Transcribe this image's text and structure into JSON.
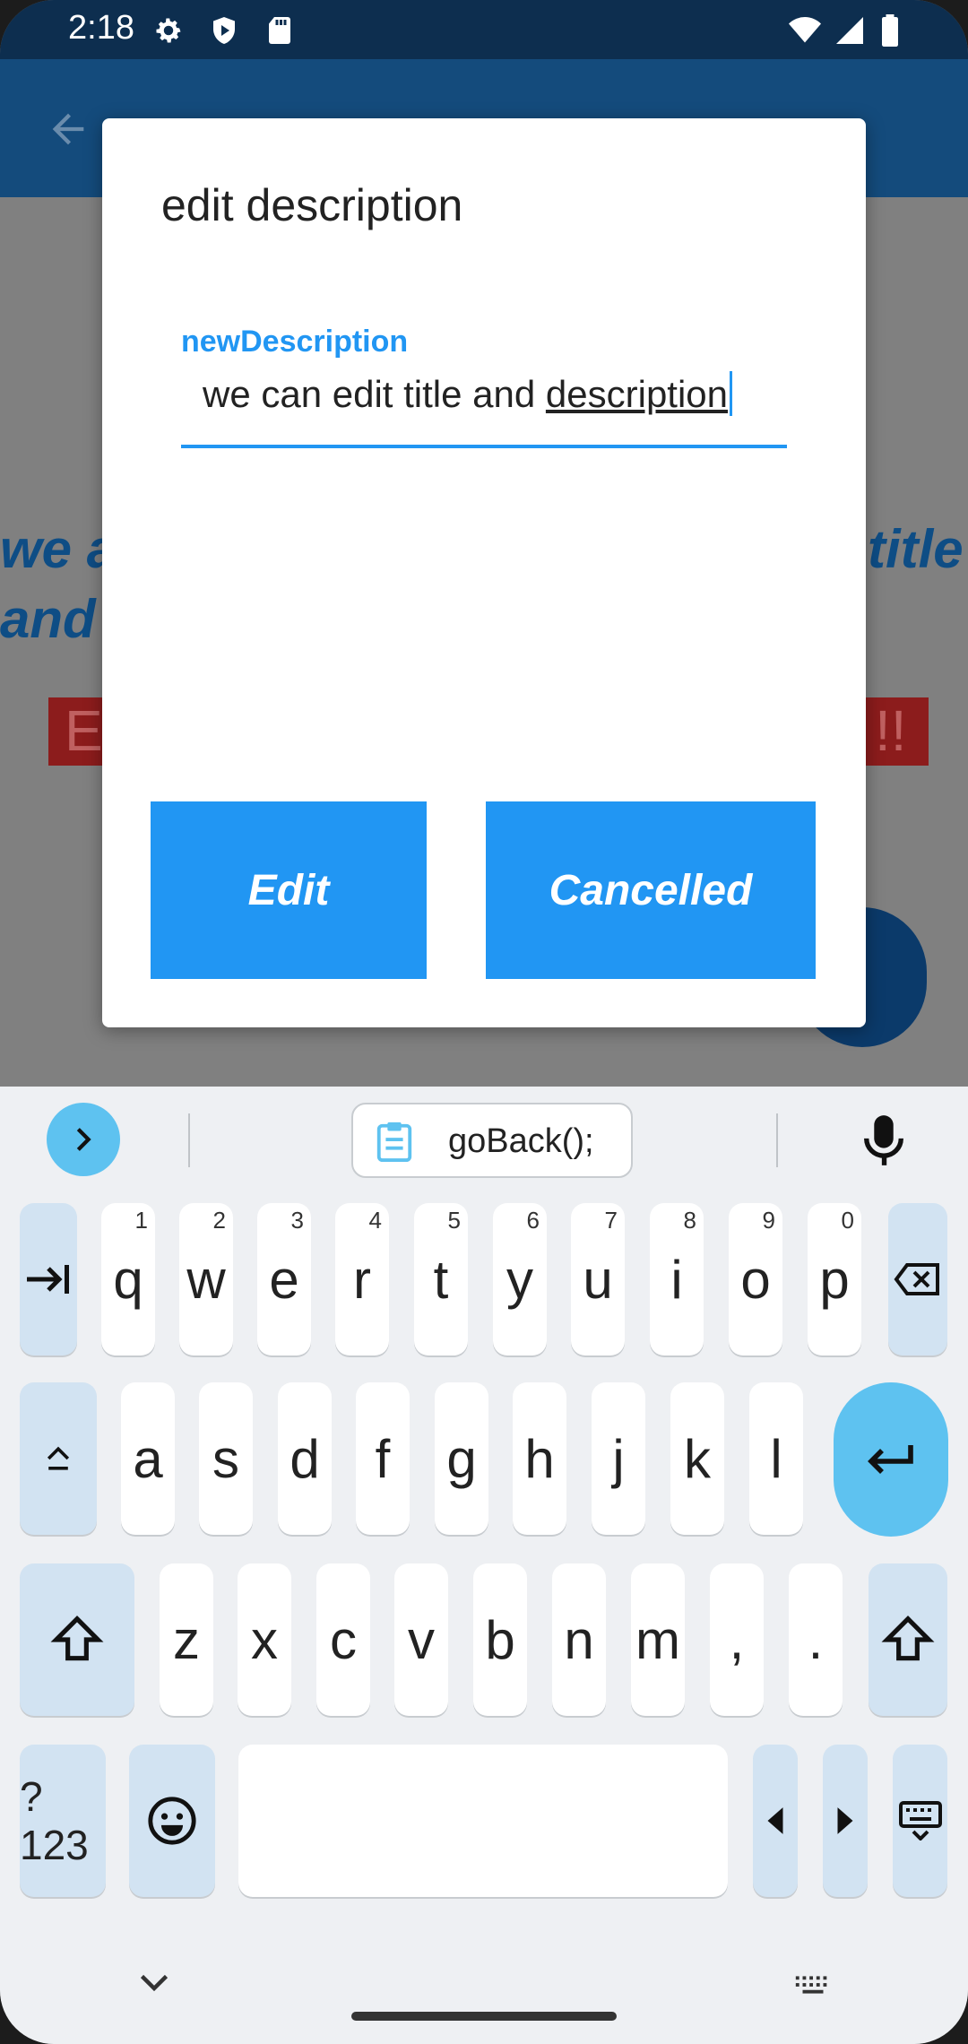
{
  "status_bar": {
    "time": "2:18"
  },
  "background": {
    "line1_left": "we a",
    "line1_right": "title",
    "line2_left": "and",
    "red_left": "E",
    "red_right": "!!"
  },
  "dialog": {
    "title": "edit description",
    "field_label": "newDescription",
    "field_value_plain": "we can edit title and ",
    "field_value_underlined": "description",
    "edit_button": "Edit",
    "cancel_button": "Cancelled"
  },
  "keyboard": {
    "clipboard_suggestion": "goBack();",
    "row1": [
      {
        "key": "q",
        "hint": "1"
      },
      {
        "key": "w",
        "hint": "2"
      },
      {
        "key": "e",
        "hint": "3"
      },
      {
        "key": "r",
        "hint": "4"
      },
      {
        "key": "t",
        "hint": "5"
      },
      {
        "key": "y",
        "hint": "6"
      },
      {
        "key": "u",
        "hint": "7"
      },
      {
        "key": "i",
        "hint": "8"
      },
      {
        "key": "o",
        "hint": "9"
      },
      {
        "key": "p",
        "hint": "0"
      }
    ],
    "row2": [
      "a",
      "s",
      "d",
      "f",
      "g",
      "h",
      "j",
      "k",
      "l"
    ],
    "row3": [
      "z",
      "x",
      "c",
      "v",
      "b",
      "n",
      "m",
      ",",
      "."
    ],
    "symbols_label": "?123"
  }
}
